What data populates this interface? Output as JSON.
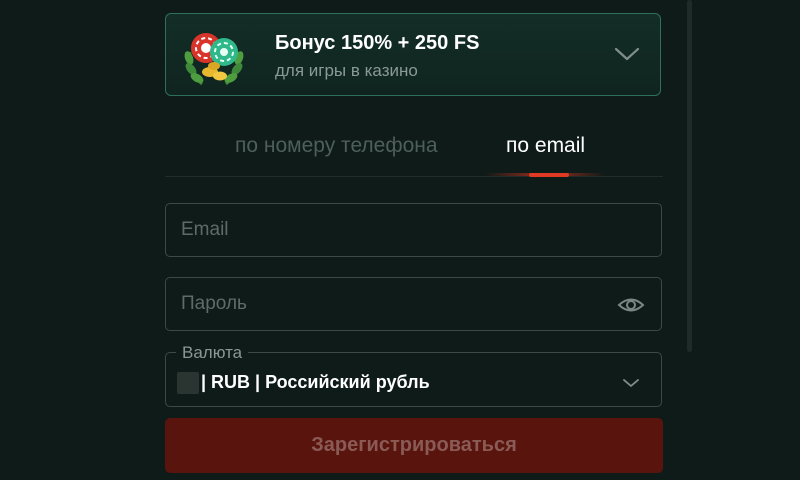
{
  "bonus": {
    "title": "Бонус 150% + 250 FS",
    "subtitle": "для игры в казино",
    "icon": "casino-chips-wreath-icon",
    "expand_icon": "chevron-down-icon"
  },
  "tabs": [
    {
      "label": "по номеру телефона",
      "active": false
    },
    {
      "label": "по email",
      "active": true
    }
  ],
  "form": {
    "email": {
      "value": "",
      "placeholder": "Email"
    },
    "password": {
      "value": "",
      "placeholder": "Пароль",
      "toggle_icon": "eye-icon"
    },
    "currency": {
      "label": "Валюта",
      "selected": "| RUB | Российский рубль",
      "icon": "chevron-down-icon"
    },
    "submit_label": "Зарегистрироваться"
  },
  "colors": {
    "accent": "#e03a22",
    "card_border": "#2f6f5c",
    "button_bg": "#5a140e",
    "background": "#0e1b18"
  }
}
